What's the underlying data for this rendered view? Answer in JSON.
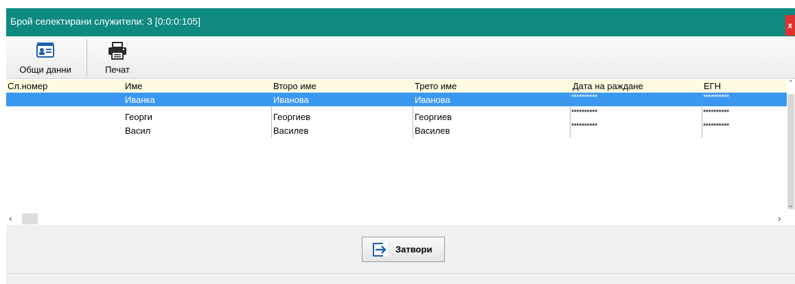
{
  "window": {
    "title": "Брой селектирани служители: 3 [0:0:0:105]",
    "close_label": "x"
  },
  "toolbar": {
    "general_label": "Общи данни",
    "print_label": "Печат"
  },
  "grid": {
    "columns": [
      "Сл.номер",
      "Име",
      "Второ име",
      "Трето име",
      "Дата на раждане",
      "ЕГН"
    ],
    "rows": [
      {
        "number": "",
        "first": "Иванка",
        "second": "Иванова",
        "third": "Иванова",
        "birth": "**********",
        "egn": "**********",
        "selected": true
      },
      {
        "number": "",
        "first": "Георги",
        "second": "Георгиев",
        "third": "Георгиев",
        "birth": "**********",
        "egn": "**********",
        "selected": false
      },
      {
        "number": "",
        "first": "Васил",
        "second": "Василев",
        "third": "Василев",
        "birth": "**********",
        "egn": "**********",
        "selected": false
      }
    ]
  },
  "footer": {
    "close_label": "Затвори"
  },
  "icons": {
    "general": "id-card-icon",
    "print": "printer-icon",
    "close": "exit-arrow-icon"
  },
  "colors": {
    "titlebar": "#0e8a80",
    "selection": "#3b98f0",
    "header": "#fffbe0",
    "close": "#e0312f"
  }
}
